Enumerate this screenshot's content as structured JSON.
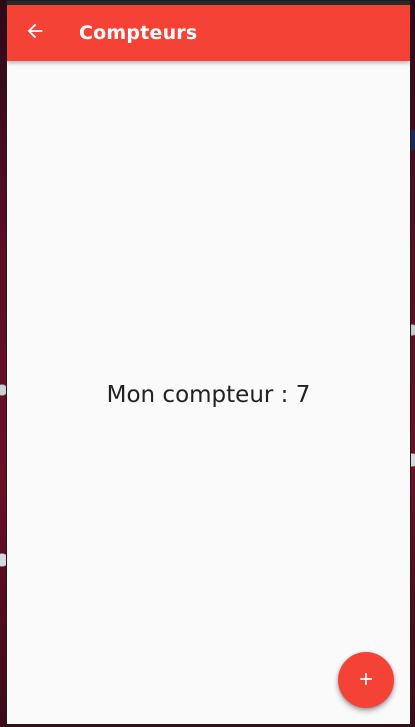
{
  "appbar": {
    "title": "Compteurs",
    "back_icon": "arrow-back-icon",
    "color": "#f44336"
  },
  "main": {
    "counter_label": "Mon compteur",
    "counter_separator": " : ",
    "counter_value": 7,
    "counter_text": "Mon compteur : 7"
  },
  "fab": {
    "icon": "plus-icon",
    "color": "#f44336"
  }
}
